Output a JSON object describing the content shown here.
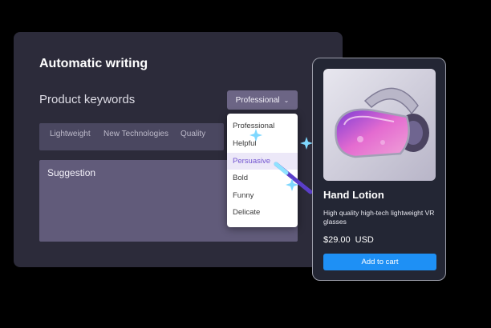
{
  "panel": {
    "title": "Automatic writing",
    "keywords_label": "Product keywords",
    "tone_select": {
      "value": "Professional",
      "icon": "chevron-down-icon"
    },
    "keyword_tags": [
      "Lightweight",
      "New Technologies",
      "Quality"
    ],
    "suggestion_label": "Suggestion",
    "tone_options": [
      "Professional",
      "Helpful",
      "Persuasive",
      "Bold",
      "Funny",
      "Delicate"
    ],
    "selected_option": "Persuasive"
  },
  "product_card": {
    "image": "vr-goggles-image",
    "title": "Hand Lotion",
    "description": "High quality high-tech lightweight VR glasses",
    "price": "$29.00",
    "currency": "USD",
    "button_label": "Add to cart"
  },
  "colors": {
    "panel_bg": "#2c2b3a",
    "tone_select_bg": "#6c6585",
    "selected_option_text": "#7356d0",
    "cart_button": "#1e90f5",
    "sparkle": "#7fd8ff"
  }
}
